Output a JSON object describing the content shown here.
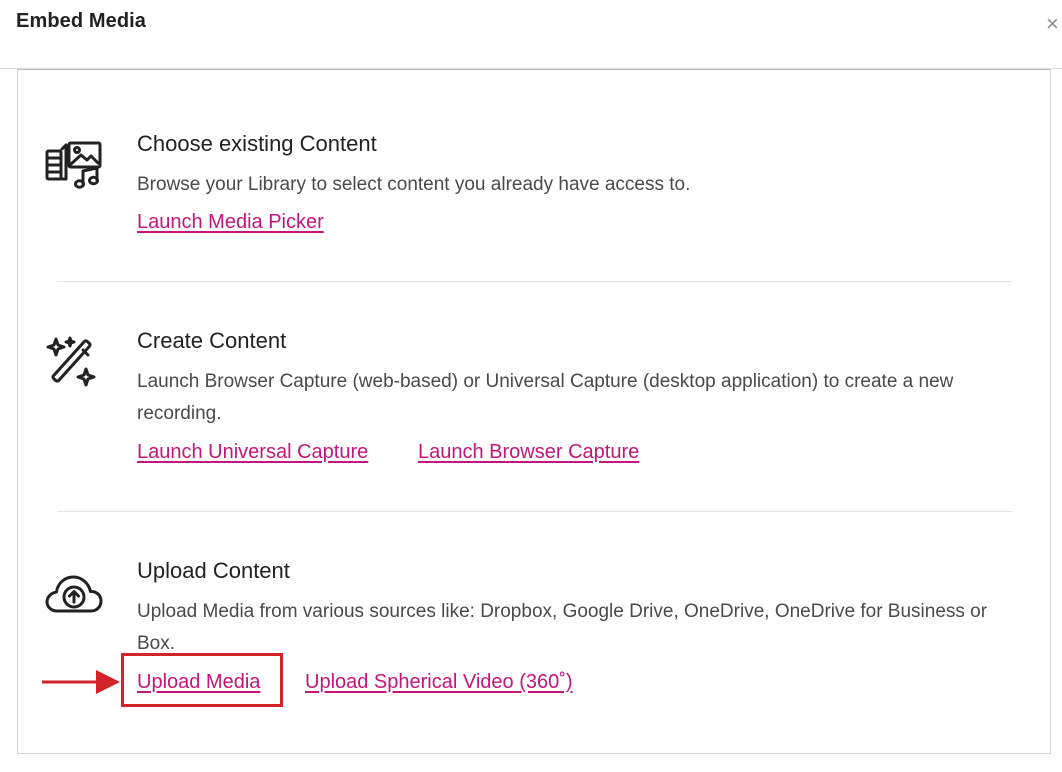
{
  "dialog": {
    "title": "Embed Media",
    "close_label": "×"
  },
  "sections": [
    {
      "icon": "media-library-icon",
      "title": "Choose existing Content",
      "description": "Browse your Library to select content you already have access to.",
      "links": [
        "Launch Media Picker"
      ]
    },
    {
      "icon": "magic-wand-icon",
      "title": "Create Content",
      "description": "Launch Browser Capture (web-based) or Universal Capture (desktop application) to create a new recording.",
      "links": [
        "Launch Universal Capture",
        "Launch Browser Capture"
      ]
    },
    {
      "icon": "cloud-upload-icon",
      "title": "Upload Content",
      "description": "Upload Media from various sources like: Dropbox, Google Drive, OneDrive, OneDrive for Business or Box.",
      "links": [
        "Upload Media",
        "Upload Spherical Video (360˚)"
      ]
    }
  ],
  "colors": {
    "link": "#c4167a",
    "highlight": "#d3232a"
  }
}
